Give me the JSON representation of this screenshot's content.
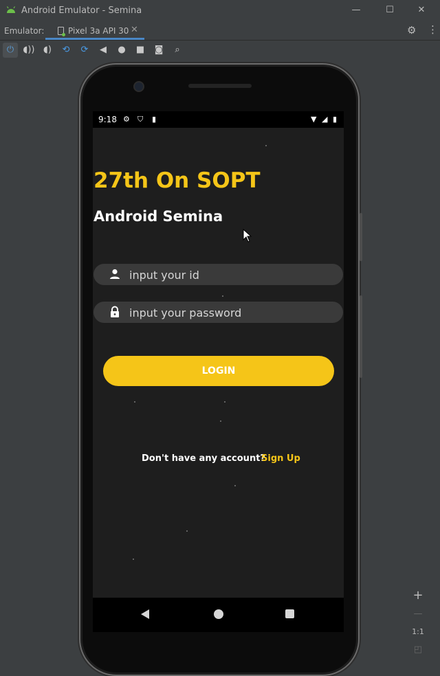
{
  "window": {
    "title": "Android Emulator - Semina",
    "minimize": "—",
    "maximize": "☐",
    "close": "✕"
  },
  "tabs": {
    "label": "Emulator:",
    "active_tab": "Pixel 3a API 30",
    "close": "✕"
  },
  "toolbar": {
    "items": [
      {
        "name": "power-icon",
        "glyph": "⏻"
      },
      {
        "name": "volume-up-icon",
        "glyph": "🔊"
      },
      {
        "name": "volume-down-icon",
        "glyph": "🔉"
      },
      {
        "name": "rotate-left-icon",
        "glyph": "⟲"
      },
      {
        "name": "rotate-right-icon",
        "glyph": "⟳"
      },
      {
        "name": "back-icon",
        "glyph": "◀"
      },
      {
        "name": "home-icon",
        "glyph": "●"
      },
      {
        "name": "overview-icon",
        "glyph": "■"
      },
      {
        "name": "screenshot-icon",
        "glyph": "📷"
      },
      {
        "name": "zoom-icon",
        "glyph": "🔍"
      }
    ]
  },
  "device": {
    "status_bar": {
      "time": "9:18"
    },
    "app": {
      "headline": "27th On SOPT",
      "subheadline": "Android Semina",
      "id_placeholder": "input your id",
      "password_placeholder": "input your password",
      "login_label": "LOGIN",
      "no_account_text": "Don't have any account?",
      "signup_label": "Sign Up"
    }
  },
  "zoom_panel": {
    "zoom_in": "+",
    "zoom_out": "—",
    "actual_size": "1:1"
  },
  "colors": {
    "accent": "#f5c518",
    "background": "#1e1e1e",
    "field": "#3a3a3a",
    "ide": "#3c3f41"
  }
}
